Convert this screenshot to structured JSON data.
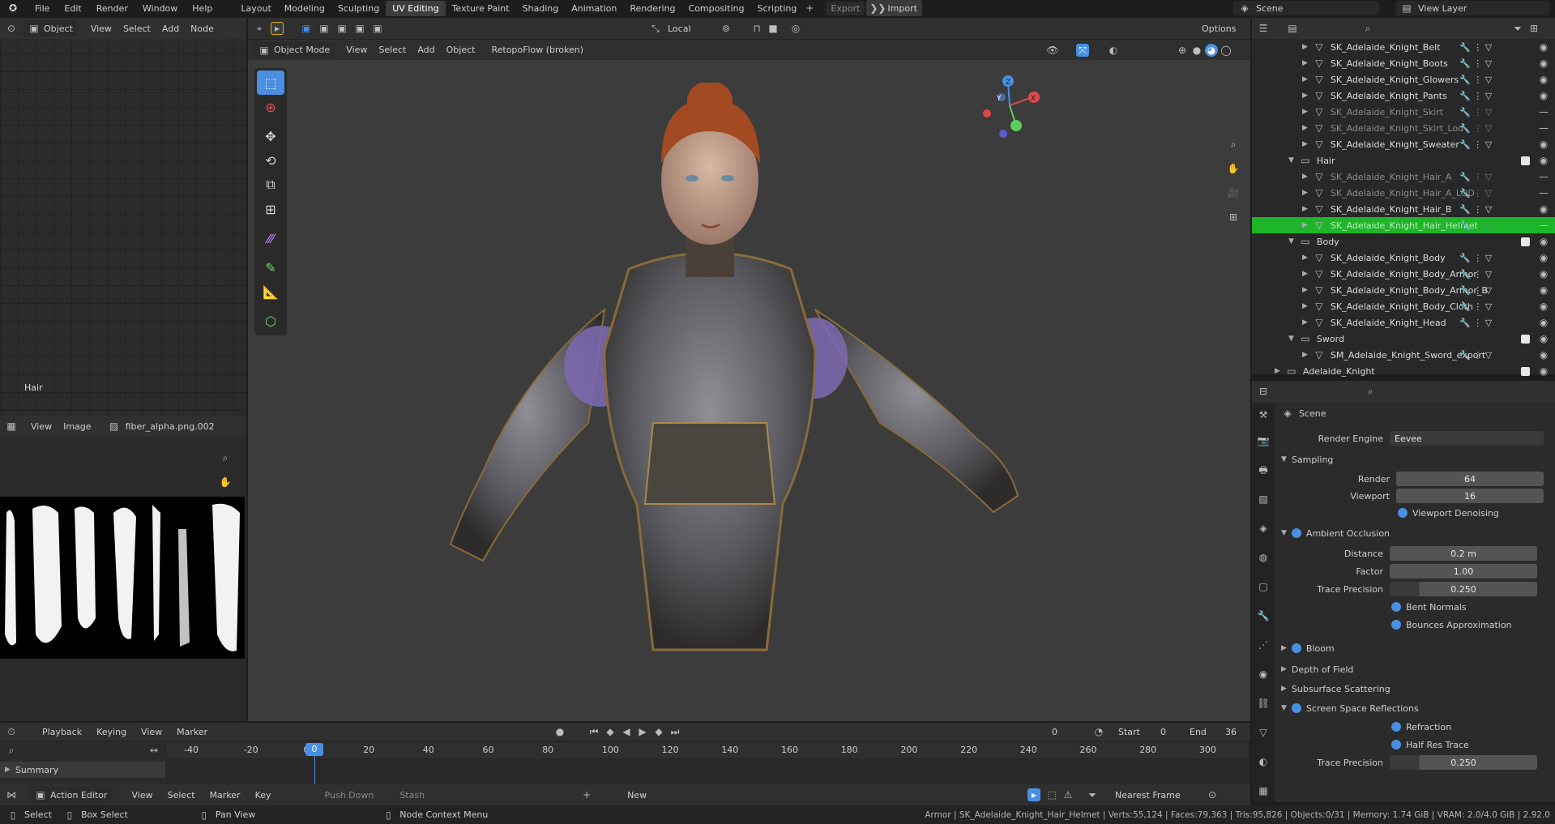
{
  "topbar": {
    "menus": [
      "File",
      "Edit",
      "Render",
      "Window",
      "Help"
    ],
    "workspaces": [
      "Layout",
      "Modeling",
      "Sculpting",
      "UV Editing",
      "Texture Paint",
      "Shading",
      "Animation",
      "Rendering",
      "Compositing",
      "Scripting"
    ],
    "active_workspace": "UV Editing",
    "export_label": "Export",
    "import_label": "Import",
    "scene": "Scene",
    "view_layer": "View Layer"
  },
  "node_editor": {
    "mode": "Object",
    "menus": [
      "View",
      "Select",
      "Add",
      "Node"
    ],
    "label": "Hair"
  },
  "image_editor": {
    "menus": [
      "View",
      "Image"
    ],
    "image_name": "fiber_alpha.png.002"
  },
  "viewport": {
    "transform_orientation": "Local",
    "options_label": "Options",
    "mode": "Object Mode",
    "menus": [
      "View",
      "Select",
      "Add",
      "Object"
    ],
    "addon_menu": "RetopoFlow (broken)",
    "gizmo": {
      "x": "X",
      "y": "Y",
      "z": "Z"
    }
  },
  "outliner": {
    "rows": [
      {
        "name": "SK_Adelaide_Knight_Belt",
        "indent": 2,
        "dim": false
      },
      {
        "name": "SK_Adelaide_Knight_Boots",
        "indent": 2,
        "dim": false
      },
      {
        "name": "SK_Adelaide_Knight_Glowers",
        "indent": 2,
        "dim": false
      },
      {
        "name": "SK_Adelaide_Knight_Pants",
        "indent": 2,
        "dim": false
      },
      {
        "name": "SK_Adelaide_Knight_Skirt",
        "indent": 2,
        "dim": true
      },
      {
        "name": "SK_Adelaide_Knight_Skirt_Lod",
        "indent": 2,
        "dim": true
      },
      {
        "name": "SK_Adelaide_Knight_Sweater",
        "indent": 2,
        "dim": false
      },
      {
        "name": "Hair",
        "indent": 1,
        "collection": true
      },
      {
        "name": "SK_Adelaide_Knight_Hair_A",
        "indent": 2,
        "dim": true
      },
      {
        "name": "SK_Adelaide_Knight_Hair_A_LOD",
        "indent": 2,
        "dim": true
      },
      {
        "name": "SK_Adelaide_Knight_Hair_B",
        "indent": 2,
        "dim": false
      },
      {
        "name": "SK_Adelaide_Knight_Hair_Helmet",
        "indent": 2,
        "dim": true,
        "selected": true
      },
      {
        "name": "Body",
        "indent": 1,
        "collection": true
      },
      {
        "name": "SK_Adelaide_Knight_Body",
        "indent": 2,
        "dim": false
      },
      {
        "name": "SK_Adelaide_Knight_Body_Armor",
        "indent": 2,
        "dim": false
      },
      {
        "name": "SK_Adelaide_Knight_Body_Armor_B",
        "indent": 2,
        "dim": false
      },
      {
        "name": "SK_Adelaide_Knight_Body_Cloth",
        "indent": 2,
        "dim": false
      },
      {
        "name": "SK_Adelaide_Knight_Head",
        "indent": 2,
        "dim": false
      },
      {
        "name": "Sword",
        "indent": 1,
        "collection": true
      },
      {
        "name": "SM_Adelaide_Knight_Sword_export",
        "indent": 2,
        "dim": false
      },
      {
        "name": "Adelaide_Knight",
        "indent": 0,
        "collection": true
      }
    ]
  },
  "properties": {
    "context": "Scene",
    "render_engine_label": "Render Engine",
    "render_engine": "Eevee",
    "sampling": {
      "title": "Sampling",
      "render_label": "Render",
      "render": "64",
      "viewport_label": "Viewport",
      "viewport": "16",
      "denoise": "Viewport Denoising"
    },
    "ao": {
      "title": "Ambient Occlusion",
      "distance_label": "Distance",
      "distance": "0.2 m",
      "factor_label": "Factor",
      "factor": "1.00",
      "trace_label": "Trace Precision",
      "trace": "0.250",
      "bent": "Bent Normals",
      "bounces": "Bounces Approximation"
    },
    "bloom": "Bloom",
    "dof": "Depth of Field",
    "sss": "Subsurface Scattering",
    "ssr": {
      "title": "Screen Space Reflections",
      "refraction": "Refraction",
      "half_res": "Half Res Trace",
      "trace_label": "Trace Precision",
      "trace": "0.250"
    }
  },
  "timeline": {
    "menus": [
      "Playback",
      "Keying",
      "View",
      "Marker"
    ],
    "current_frame": "0",
    "start_label": "Start",
    "start": "0",
    "end_label": "End",
    "end": "36",
    "ruler": [
      "-40",
      "-20",
      "0",
      "20",
      "40",
      "60",
      "80",
      "100",
      "120",
      "140",
      "160",
      "180",
      "200",
      "220",
      "240",
      "260",
      "280",
      "300"
    ],
    "summary": "Summary"
  },
  "action_editor": {
    "mode": "Action Editor",
    "menus": [
      "View",
      "Select",
      "Marker",
      "Key"
    ],
    "push_down": "Push Down",
    "stash": "Stash",
    "new_label": "New",
    "snap": "Nearest Frame"
  },
  "statusbar": {
    "select": "Select",
    "box_select": "Box Select",
    "pan_view": "Pan View",
    "node_menu": "Node Context Menu",
    "stats": "Armor | SK_Adelaide_Knight_Hair_Helmet | Verts:55,124 | Faces:79,363 | Tris:95,826 | Objects:0/31 | Memory: 1.74 GiB | VRAM: 2.0/4.0 GiB | 2.92.0"
  },
  "colors": {
    "accent": "#4a8fe2",
    "selected_row": "#1fb52a",
    "bg": "#1d1d1d",
    "panel": "#303030"
  }
}
